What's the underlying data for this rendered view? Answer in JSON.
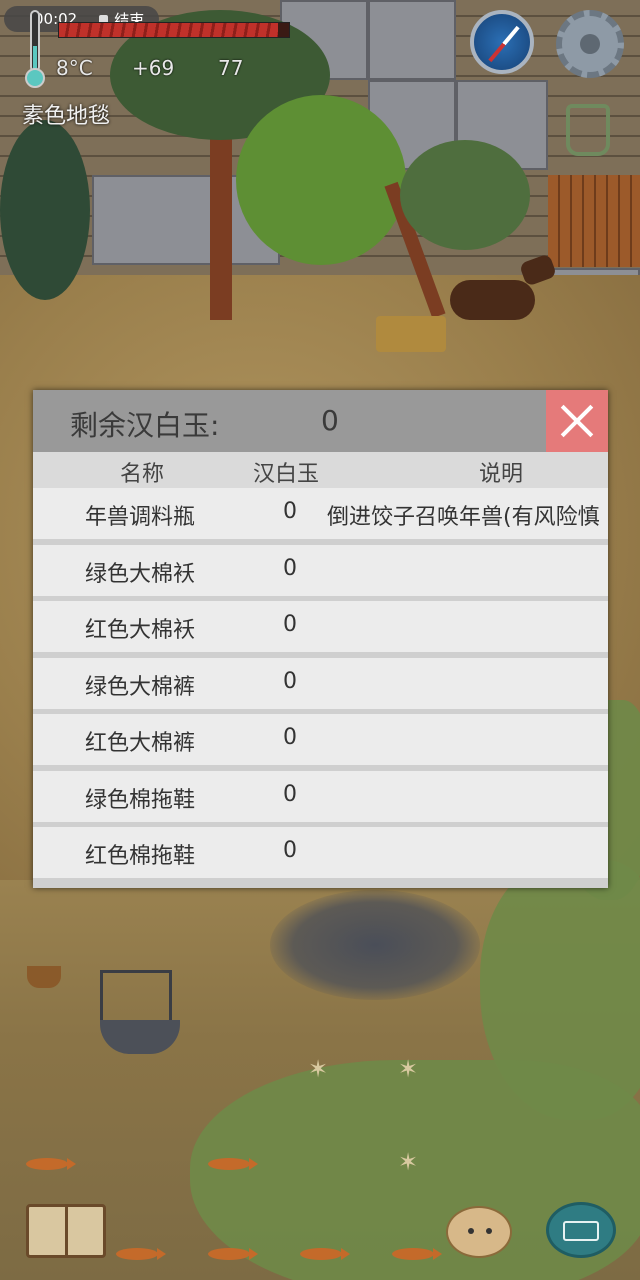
{
  "status_bar": {
    "time": "00:02",
    "recording_label": "结束"
  },
  "hud": {
    "temperature": "8°C",
    "value_1": "+69",
    "value_2": "77",
    "location": "素色地毯",
    "health_fraction": 0.95
  },
  "dialog": {
    "remaining_label": "剩余汉白玉:",
    "remaining_value": "0",
    "columns": {
      "name": "名称",
      "cost": "汉白玉",
      "description": "说明"
    },
    "rows": [
      {
        "name": "年兽调料瓶",
        "cost": "0",
        "description": "倒进饺子召唤年兽(有风险慎"
      },
      {
        "name": "绿色大棉袄",
        "cost": "0",
        "description": ""
      },
      {
        "name": "红色大棉袄",
        "cost": "0",
        "description": ""
      },
      {
        "name": "绿色大棉裤",
        "cost": "0",
        "description": ""
      },
      {
        "name": "红色大棉裤",
        "cost": "0",
        "description": ""
      },
      {
        "name": "绿色棉拖鞋",
        "cost": "0",
        "description": ""
      },
      {
        "name": "红色棉拖鞋",
        "cost": "0",
        "description": ""
      }
    ]
  },
  "colors": {
    "close_button": "#e57a7a",
    "header": "#999999",
    "row": "#ececec"
  },
  "icons": [
    "thermometer-icon",
    "compass-icon",
    "settings-gear-icon",
    "backpack-icon",
    "journal-book-icon",
    "potato-character-icon",
    "keyboard-chat-icon",
    "close-icon"
  ]
}
